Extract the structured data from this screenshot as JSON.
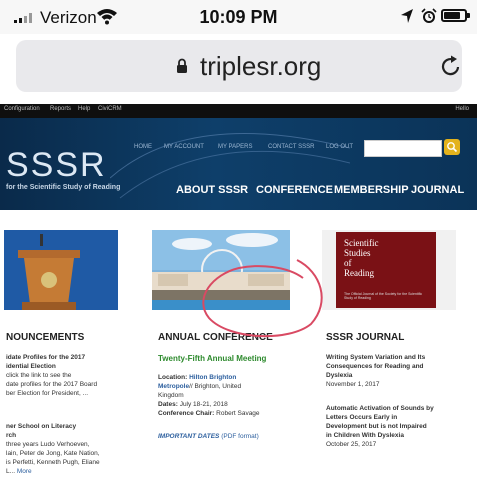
{
  "status_bar": {
    "carrier": "Verizon",
    "time": "10:09 PM"
  },
  "address_bar": {
    "url": "triplesr.org"
  },
  "admin_bar": {
    "items": [
      "Configuration",
      "Reports",
      "Help",
      "CiviCRM"
    ],
    "hello": "Hello"
  },
  "header": {
    "logo": "SSSR",
    "tagline": "for the Scientific Study of Reading",
    "top_nav": [
      "HOME",
      "MY ACCOUNT",
      "MY PAPERS",
      "CONTACT SSSR",
      "LOG OUT"
    ],
    "main_nav": [
      "ABOUT SSSR",
      "CONFERENCE",
      "MEMBERSHIP",
      "JOURNAL"
    ]
  },
  "announcements": {
    "title": "NOUNCEMENTS",
    "item1_title": "idate Profiles for the 2017",
    "item1_title2": "idential Election",
    "item1_body": [
      " click the link to see the",
      "date profiles for the 2017 Board",
      "ber Election for President, ..."
    ],
    "item2_title": "ner School on Literacy",
    "item2_title2": "rch",
    "item2_body": [
      "three years Ludo Verhoeven,",
      "lain, Peter de Jong, Kate Nation,",
      "is Perfetti, Kenneth Pugh, Eliane",
      "L..."
    ],
    "more": "More"
  },
  "conference": {
    "title": "ANNUAL CONFERENCE",
    "subtitle": "Twenty-Fifth Annual Meeting",
    "location_label": "Location:",
    "location_value1": "Hilton Brighton",
    "location_value2": "Metropole",
    "location_value3": "// Brighton, United",
    "location_value4": "Kingdom",
    "dates_label": "Dates:",
    "dates_value": "July 18-21, 2018",
    "chair_label": "Conference Chair:",
    "chair_value": "Robert Savage",
    "important": "IMPORTANT DATES",
    "pdf": "(PDF format)"
  },
  "journal": {
    "title": "SSSR JOURNAL",
    "cover_title": [
      "Scientific",
      "Studies",
      "of",
      "Reading"
    ],
    "cover_sub": "The Official Journal of the Society for the Scientific Study of Reading",
    "a1": [
      "Writing System Variation and Its",
      "Consequences for Reading and",
      "Dyslexia"
    ],
    "a1_date": "November 1, 2017",
    "a2": [
      "Automatic Activation of Sounds by",
      "Letters Occurs Early in",
      "Development but is not Impaired",
      "in Children With Dyslexia"
    ],
    "a2_date": "October 25, 2017"
  }
}
